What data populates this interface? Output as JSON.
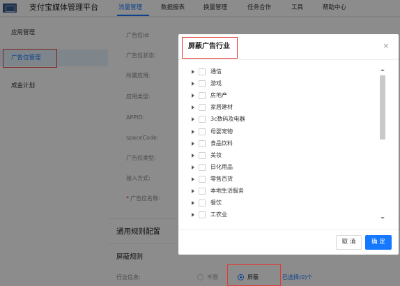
{
  "app": {
    "title": "支付宝媒体管理平台"
  },
  "nav": {
    "items": [
      {
        "label": "流量管理",
        "active": true
      },
      {
        "label": "数据报表",
        "active": false
      },
      {
        "label": "换量管理",
        "active": false
      },
      {
        "label": "任务合作",
        "active": false
      },
      {
        "label": "工具",
        "active": false
      },
      {
        "label": "帮助中心",
        "active": false
      }
    ]
  },
  "sidebar": {
    "items": [
      {
        "label": "应用管理",
        "active": false
      },
      {
        "label": "广告位管理",
        "active": true
      },
      {
        "label": "成金计划",
        "active": false
      }
    ]
  },
  "form": {
    "labels": [
      {
        "label": "广告位id:",
        "required": false
      },
      {
        "label": "广告位状态:",
        "required": false
      },
      {
        "label": "所属应用:",
        "required": false
      },
      {
        "label": "应用类型:",
        "required": false
      },
      {
        "label": "APPID:",
        "required": false
      },
      {
        "label": "spaceCode:",
        "required": false
      },
      {
        "label": "广告位类型:",
        "required": false
      },
      {
        "label": "接入方式:",
        "required": false
      },
      {
        "label": "广告位名称:",
        "required": true
      }
    ],
    "required_mark": "*"
  },
  "rules": {
    "section_title": "通用规则配置",
    "subsection_title": "屏蔽规则",
    "industry_label": "行业信息:",
    "option_unlimited": "不限",
    "option_block": "屏蔽",
    "selected_option": "屏蔽",
    "selected_link": "已选择(0)个"
  },
  "modal": {
    "title": "屏蔽广告行业",
    "close_glyph": "×",
    "industries": [
      "通信",
      "游戏",
      "房地产",
      "家居建材",
      "3c数码及电器",
      "母婴宠物",
      "食品饮料",
      "美妆",
      "日化用品",
      "零售百货",
      "本地生活服务",
      "餐饮",
      "工农业"
    ],
    "cancel_label": "取 消",
    "ok_label": "确 定"
  },
  "colors": {
    "primary": "#1677ff",
    "highlight_box": "#e53935",
    "mask": "rgba(0,0,0,0.45)"
  }
}
